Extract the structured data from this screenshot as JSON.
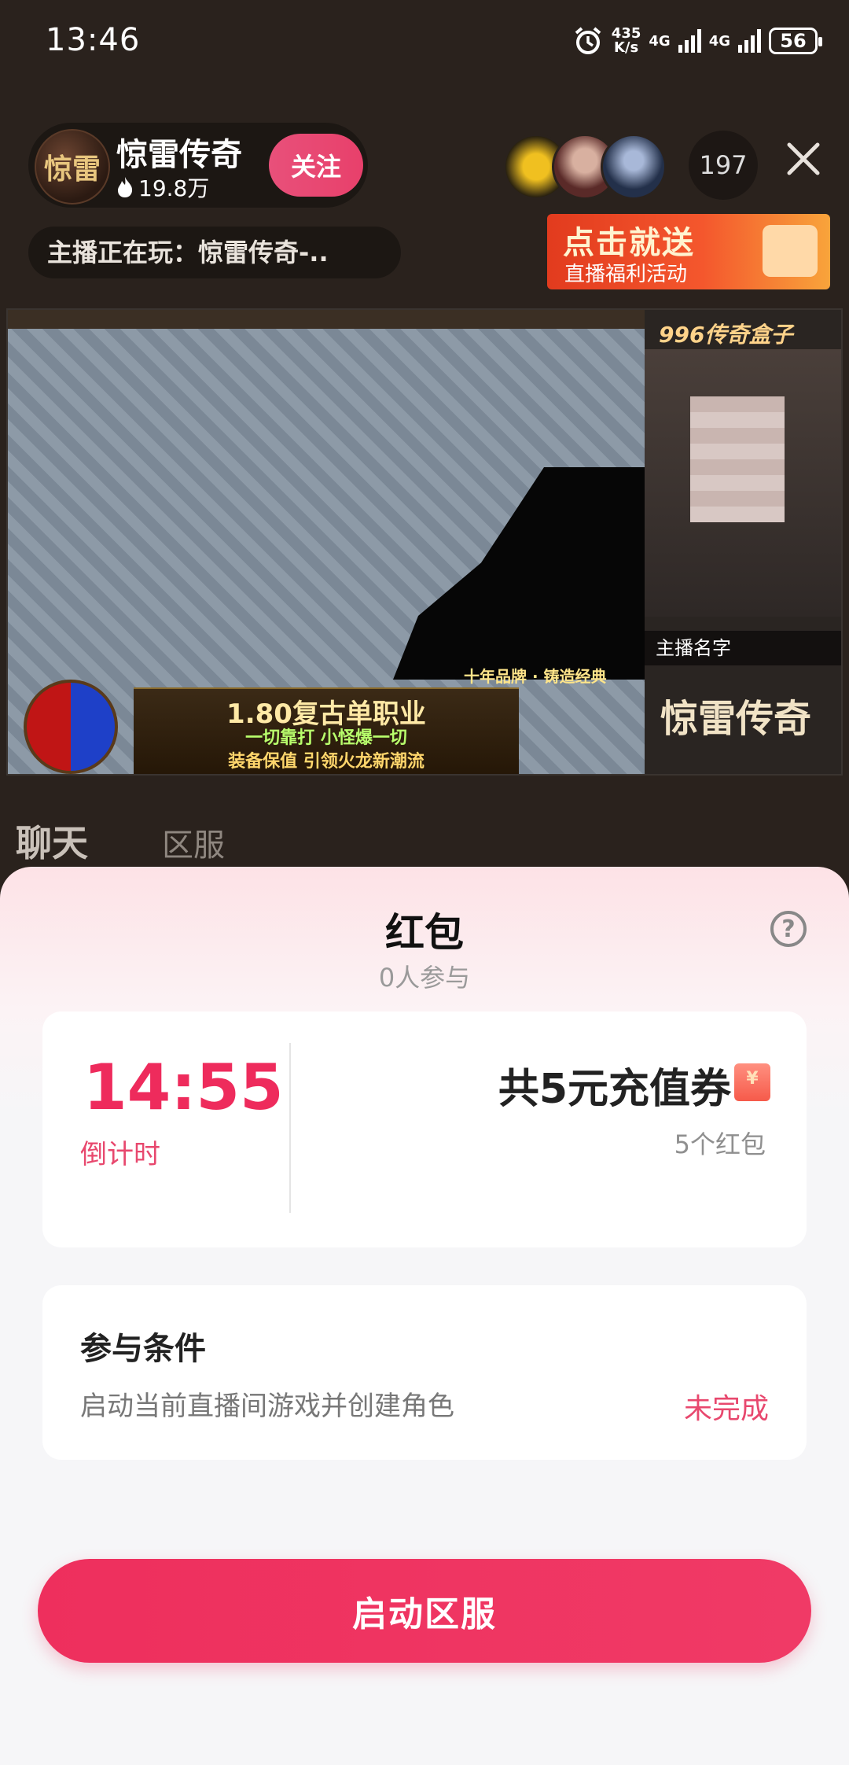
{
  "status_bar": {
    "time": "13:46",
    "net_speed": "435\nK/s",
    "net_speed_value": "435",
    "net_speed_unit": "K/s",
    "sim1": "4G",
    "sim2": "4G",
    "battery": "56"
  },
  "header": {
    "streamer_name": "惊雷传奇",
    "avatar_text": "惊雷",
    "heat": "19.8万",
    "follow_label": "关注",
    "viewer_count": "197",
    "now_playing": "主播正在玩：惊雷传奇-..",
    "promo_title": "点击就送",
    "promo_subtitle": "直播福利活动"
  },
  "video": {
    "banner_line1": "1.80复古单职业",
    "banner_line2": "一切靠打 小怪爆一切",
    "banner_line3": "装备保值 引领火龙新潮流",
    "slogan": "十年品牌 · 铸造经典",
    "cam_brand": "996传奇盒子",
    "cam_name_label": "主播名字",
    "cam_logo": "惊雷传奇"
  },
  "tabs": {
    "chat": "聊天",
    "server": "区服"
  },
  "sheet": {
    "title": "红包",
    "participants": "0人参与",
    "help": "?",
    "countdown": "14:55",
    "countdown_label": "倒计时",
    "total": "共5元充值券",
    "envelope_icon_glyph": "¥",
    "envelope_count": "5个红包",
    "condition_title": "参与条件",
    "condition_text": "启动当前直播间游戏并创建角色",
    "condition_status": "未完成",
    "cta_label": "启动区服"
  },
  "colors": {
    "accent": "#ee2b5c",
    "follow": "#e8507a",
    "background": "#2a221d",
    "sheet": "#f6f6f8"
  }
}
